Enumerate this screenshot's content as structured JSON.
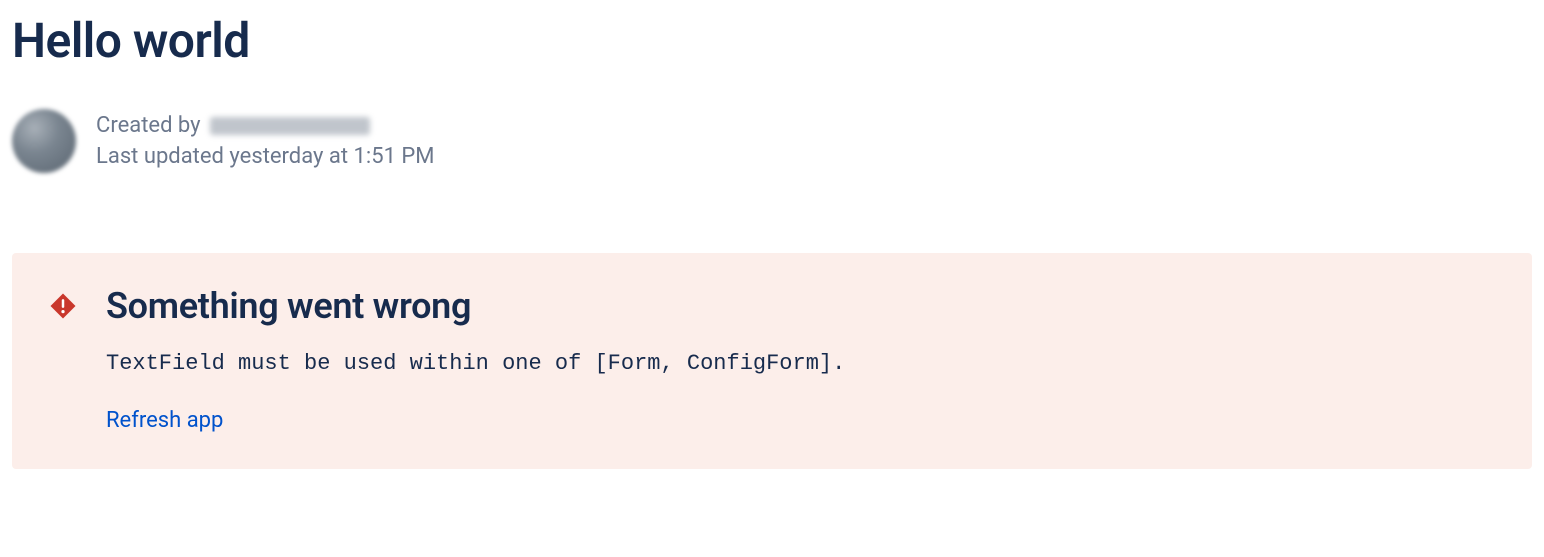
{
  "page": {
    "title": "Hello world"
  },
  "byline": {
    "created_by_label": "Created by",
    "last_updated": "Last updated yesterday at 1:51 PM"
  },
  "error": {
    "title": "Something went wrong",
    "message": "TextField must be used within one of [Form, ConfigForm].",
    "refresh_label": "Refresh app"
  },
  "colors": {
    "text_primary": "#172B4D",
    "text_secondary": "#6B778C",
    "link": "#0052CC",
    "error_bg": "#FCEEEA",
    "error_icon": "#C9372C"
  }
}
